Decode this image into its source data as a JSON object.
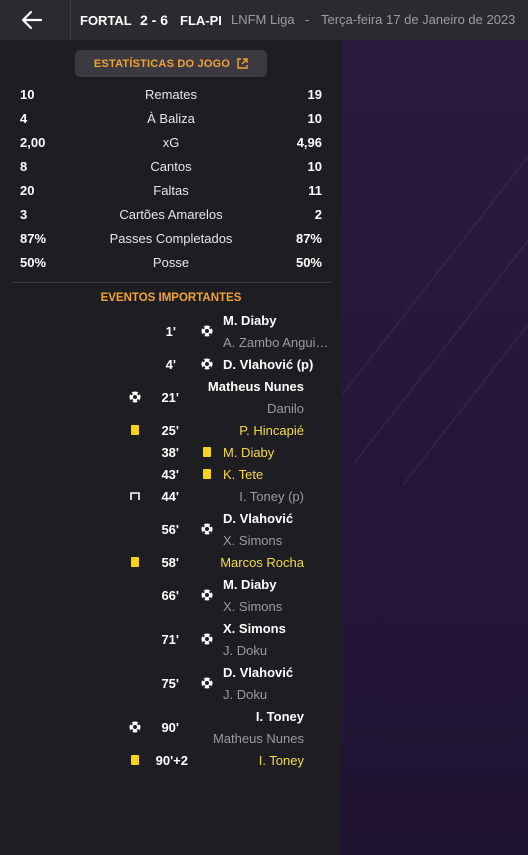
{
  "header": {
    "home_team": "FORTAL",
    "score": "2 - 6",
    "away_team": "FLA-PI",
    "competition": "LNFM Liga",
    "separator": "-",
    "date": "Terça-feira 17 de Janeiro de 2023"
  },
  "stats_button": {
    "label": "ESTATÍSTICAS DO JOGO",
    "icon": "external-link-icon"
  },
  "stats": [
    {
      "home": "10",
      "label": "Remates",
      "away": "19"
    },
    {
      "home": "4",
      "label": "À Baliza",
      "away": "10"
    },
    {
      "home": "2,00",
      "label": "xG",
      "away": "4,96"
    },
    {
      "home": "8",
      "label": "Cantos",
      "away": "10"
    },
    {
      "home": "20",
      "label": "Faltas",
      "away": "11"
    },
    {
      "home": "3",
      "label": "Cartões Amarelos",
      "away": "2"
    },
    {
      "home": "87%",
      "label": "Passes Completados",
      "away": "87%"
    },
    {
      "home": "50%",
      "label": "Posse",
      "away": "50%"
    }
  ],
  "events_title": "EVENTOS IMPORTANTES",
  "events": {
    "e1": {
      "minute": "1'",
      "player": "M. Diaby",
      "assist": "A. Zambo Anguissa"
    },
    "e2": {
      "minute": "4'",
      "player": "D. Vlahović (p)"
    },
    "e3": {
      "minute": "21'",
      "player": "Matheus Nunes",
      "assist": "Danilo"
    },
    "e4": {
      "minute": "25'",
      "player": "P. Hincapié"
    },
    "e5": {
      "minute": "38'",
      "player": "M. Diaby"
    },
    "e6": {
      "minute": "43'",
      "player": "K. Tete"
    },
    "e7": {
      "minute": "44'",
      "player": "I. Toney (p)"
    },
    "e8": {
      "minute": "56'",
      "player": "D. Vlahović",
      "assist": "X. Simons"
    },
    "e9": {
      "minute": "58'",
      "player": "Marcos Rocha"
    },
    "e10": {
      "minute": "66'",
      "player": "M. Diaby",
      "assist": "X. Simons"
    },
    "e11": {
      "minute": "71'",
      "player": "X. Simons",
      "assist": "J. Doku"
    },
    "e12": {
      "minute": "75'",
      "player": "D. Vlahović",
      "assist": "J. Doku"
    },
    "e13": {
      "minute": "90'",
      "player": "I. Toney",
      "assist": "Matheus Nunes"
    },
    "e14": {
      "minute": "90'+2",
      "player": "I. Toney"
    }
  },
  "colors": {
    "accent": "#f2a233",
    "yellow_card": "#f8d41b",
    "yellow_text": "#f5d94a",
    "background": "#1e1e22",
    "header": "#2a2a2f",
    "side_panel": "#2a1a3e"
  }
}
